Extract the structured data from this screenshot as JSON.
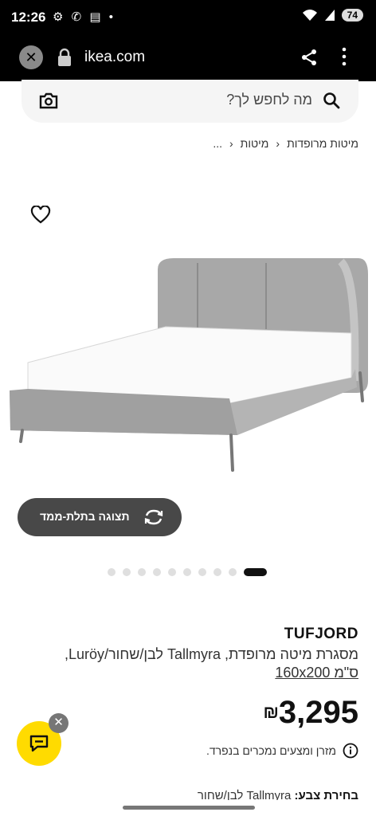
{
  "status_bar": {
    "time": "12:26",
    "icons": "⚙ ✆ ▤ •",
    "battery": "74"
  },
  "browser": {
    "url": "ikea.com"
  },
  "search": {
    "placeholder": "מה לחפש לך?"
  },
  "breadcrumb": {
    "ellipsis": "...",
    "items": [
      "מיטות",
      "מיטות מרופדות"
    ]
  },
  "product": {
    "name": "TUFJORD",
    "description": "מסגרת מיטה מרופדת, Tallmyra לבן/שחור/Luröy,",
    "size": "160x200 ס\"מ",
    "price": "3,295",
    "currency": "₪",
    "note": "מזרן ומצעים נמכרים בנפרד.",
    "color_label": "בחירת צבע:",
    "color_value": "Tallmyra לבן/שחור"
  },
  "view3d": {
    "label": "תצוגה בתלת-ממד"
  },
  "carousel": {
    "count": 10,
    "active_index": 0
  },
  "colors": {
    "accent": "#ffdb00",
    "button": "#484848"
  }
}
